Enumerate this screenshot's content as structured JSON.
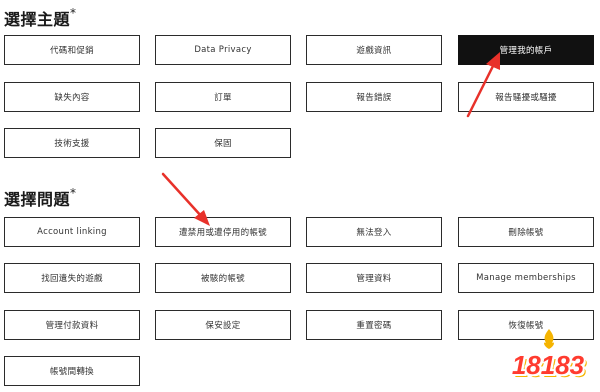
{
  "topic_section": {
    "heading": "選擇主題",
    "required_mark": "*",
    "options": [
      "代碼和促銷",
      "Data Privacy",
      "遊戲資訊",
      "管理我的帳戶",
      "缺失內容",
      "訂單",
      "報告錯誤",
      "報告騷擾或騷擾",
      "技術支援",
      "保固"
    ],
    "selected": "管理我的帳戶"
  },
  "issue_section": {
    "heading": "選擇問題",
    "required_mark": "*",
    "options": [
      "Account linking",
      "遭禁用或遭停用的帳號",
      "無法登入",
      "刪除帳號",
      "找回遺失的遊戲",
      "被駭的帳號",
      "管理資料",
      "Manage memberships",
      "管理付款資料",
      "保安設定",
      "重置密碼",
      "恢復帳號",
      "帳號間轉換"
    ]
  },
  "watermark": {
    "text": "18183",
    "colors": {
      "primary": "#ff3b2f",
      "shadow": "#f5b400"
    }
  },
  "annotations": {
    "arrow_color": "#e8312a"
  }
}
